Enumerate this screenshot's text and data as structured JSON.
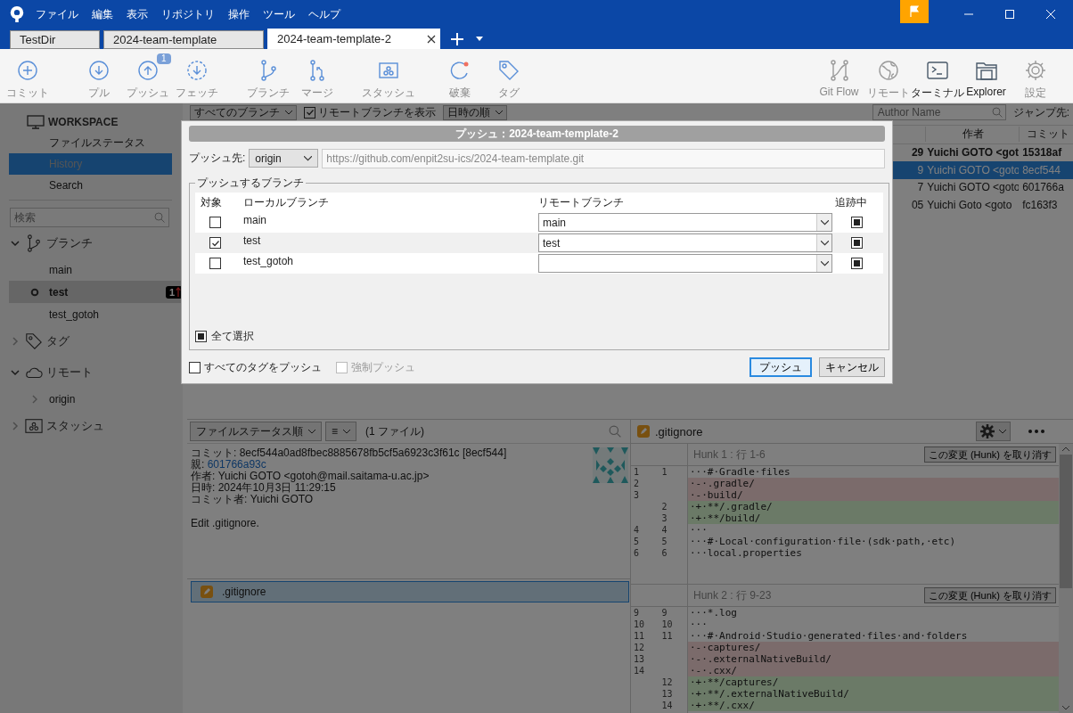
{
  "title_bar": {
    "menu": [
      "ファイル",
      "編集",
      "表示",
      "リポジトリ",
      "操作",
      "ツール",
      "ヘルプ"
    ]
  },
  "tabs": [
    {
      "label": "TestDir",
      "selected": false
    },
    {
      "label": "2024-team-template",
      "selected": false
    },
    {
      "label": "2024-team-template-2",
      "selected": true
    }
  ],
  "toolbar": {
    "left_groups": [
      [
        {
          "kind": "commit",
          "label": "コミット",
          "disabled": true
        }
      ],
      [
        {
          "kind": "pull",
          "label": "プル",
          "disabled": true
        },
        {
          "kind": "push",
          "label": "プッシュ",
          "disabled": true,
          "badge": "1"
        },
        {
          "kind": "fetch",
          "label": "フェッチ",
          "disabled": true
        }
      ],
      [
        {
          "kind": "branch",
          "label": "ブランチ",
          "disabled": true
        },
        {
          "kind": "merge",
          "label": "マージ",
          "disabled": true
        }
      ],
      [
        {
          "kind": "stash",
          "label": "スタッシュ",
          "disabled": true
        }
      ],
      [
        {
          "kind": "discard",
          "label": "破棄",
          "disabled": true
        },
        {
          "kind": "tag",
          "label": "タグ",
          "disabled": true
        }
      ]
    ],
    "right": [
      {
        "kind": "gitflow",
        "label": "Git Flow",
        "disabled": true
      },
      {
        "kind": "remote",
        "label": "リモート",
        "disabled": true
      },
      {
        "kind": "terminal",
        "label": "ターミナル",
        "disabled": false
      },
      {
        "kind": "explorer",
        "label": "Explorer",
        "disabled": false
      },
      {
        "kind": "settings",
        "label": "設定",
        "disabled": true
      }
    ]
  },
  "sidebar": {
    "workspace": {
      "title": "WORKSPACE",
      "items": [
        {
          "label": "ファイルステータス",
          "selected": false
        },
        {
          "label": "History",
          "selected": true
        },
        {
          "label": "Search",
          "selected": false
        }
      ]
    },
    "search": {
      "placeholder": "検索"
    },
    "sections": [
      {
        "kind": "branch",
        "label": "ブランチ",
        "expanded": true,
        "children": [
          {
            "label": "main",
            "selected": false,
            "current": false
          },
          {
            "label": "test",
            "selected": true,
            "current": true,
            "badge": "1"
          },
          {
            "label": "test_gotoh",
            "selected": false,
            "current": false
          }
        ]
      },
      {
        "kind": "tag",
        "label": "タグ",
        "expanded": false
      },
      {
        "kind": "cloud",
        "label": "リモート",
        "expanded": true,
        "children": [
          {
            "label": "origin",
            "expanded": false
          }
        ]
      },
      {
        "kind": "stash",
        "label": "スタッシュ",
        "expanded": false
      }
    ]
  },
  "history": {
    "branch_filter": "すべてのブランチ",
    "show_remote": {
      "label": "リモートブランチを表示",
      "checked": true
    },
    "sort": "日時の順",
    "author_search": {
      "placeholder": "Author Name"
    },
    "jump_label": "ジャンプ先:",
    "columns": [
      "",
      "作者",
      "コミット"
    ],
    "rows": [
      {
        "cells": [
          "29",
          "Yuichi GOTO <got",
          "15318af"
        ],
        "head": true,
        "selected": false
      },
      {
        "cells": [
          "9",
          "Yuichi GOTO <goto",
          "8ecf544"
        ],
        "head": false,
        "selected": true
      },
      {
        "cells": [
          "7",
          "Yuichi GOTO <goto",
          "601766a"
        ],
        "head": false,
        "selected": false
      },
      {
        "cells": [
          "05",
          "Yuichi Goto <goto",
          "fc163f3"
        ],
        "head": false,
        "selected": false
      }
    ]
  },
  "files_panel": {
    "sort": "ファイルステータス順",
    "view": "≡",
    "count": "(1 ファイル)",
    "details": [
      {
        "label": "コミット:",
        "value": "8ecf544a0ad8fbec8885678fb5cf5a6923c3f61c [8ecf544]",
        "link": false
      },
      {
        "label": "親:",
        "value": "601766a93c",
        "link": true
      },
      {
        "label": "作者:",
        "value": "Yuichi GOTO <gotoh@mail.saitama-u.ac.jp>",
        "link": false
      },
      {
        "label": "日時:",
        "value": "2024年10月3日 11:29:15",
        "link": false
      },
      {
        "label": "コミット者:",
        "value": "Yuichi GOTO",
        "link": false
      }
    ],
    "message": "Edit .gitignore.",
    "files": [
      {
        "name": ".gitignore",
        "selected": true
      }
    ]
  },
  "diff": {
    "file": ".gitignore",
    "hunks": [
      {
        "title": "Hunk 1 : 行 1-6",
        "button": "この変更 (Hunk) を取り消す",
        "lines": [
          {
            "old": "1",
            "new": "1",
            "kind": "context",
            "text": "···#·Gradle·files"
          },
          {
            "old": "2",
            "kind": "removed",
            "text": "·-·.gradle/"
          },
          {
            "old": "3",
            "kind": "removed",
            "text": "·-·build/"
          },
          {
            "new": "2",
            "kind": "added",
            "text": "·+·**/.gradle/"
          },
          {
            "new": "3",
            "kind": "added",
            "text": "·+·**/build/"
          },
          {
            "old": "4",
            "new": "4",
            "kind": "context",
            "text": "···"
          },
          {
            "old": "5",
            "new": "5",
            "kind": "context",
            "text": "···#·Local·configuration·file·(sdk·path,·etc)"
          },
          {
            "old": "6",
            "new": "6",
            "kind": "context",
            "text": "···local.properties"
          }
        ]
      },
      {
        "title": "Hunk 2 : 行 9-23",
        "button": "この変更 (Hunk) を取り消す",
        "lines": [
          {
            "old": "9",
            "new": "9",
            "kind": "context",
            "text": "···*.log"
          },
          {
            "old": "10",
            "new": "10",
            "kind": "context",
            "text": "···"
          },
          {
            "old": "11",
            "new": "11",
            "kind": "context",
            "text": "···#·Android·Studio·generated·files·and·folders"
          },
          {
            "old": "12",
            "kind": "removed",
            "text": "·-·captures/"
          },
          {
            "old": "13",
            "kind": "removed",
            "text": "·-·.externalNativeBuild/"
          },
          {
            "old": "14",
            "kind": "removed",
            "text": "·-·.cxx/"
          },
          {
            "new": "12",
            "kind": "added",
            "text": "·+·**/captures/"
          },
          {
            "new": "13",
            "kind": "added",
            "text": "·+·**/.externalNativeBuild/"
          },
          {
            "new": "14",
            "kind": "added",
            "text": "·+·**/.cxx/"
          }
        ]
      }
    ]
  },
  "dialog": {
    "title": "プッシュ：2024-team-template-2",
    "push_to_label": "プッシュ先:",
    "remote": "origin",
    "url": "https://github.com/enpit2su-ics/2024-team-template.git",
    "group_title": "プッシュするブランチ",
    "columns": [
      "対象",
      "ローカルブランチ",
      "リモートブランチ",
      "追跡中"
    ],
    "rows": [
      {
        "checked": false,
        "local": "main",
        "remote": "main",
        "tracking": true
      },
      {
        "checked": true,
        "local": "test",
        "remote": "test",
        "tracking": true
      },
      {
        "checked": false,
        "local": "test_gotoh",
        "tracking": true
      }
    ],
    "select_all": {
      "label": "全て選択",
      "indeterminate": true
    },
    "push_tags": {
      "label": "すべてのタグをプッシュ",
      "checked": false
    },
    "force_push": {
      "label": "強制プッシュ",
      "checked": false,
      "disabled": true
    },
    "buttons": [
      {
        "label": "プッシュ",
        "kind": "primary"
      },
      {
        "label": "キャンセル",
        "kind": "normal"
      }
    ]
  }
}
